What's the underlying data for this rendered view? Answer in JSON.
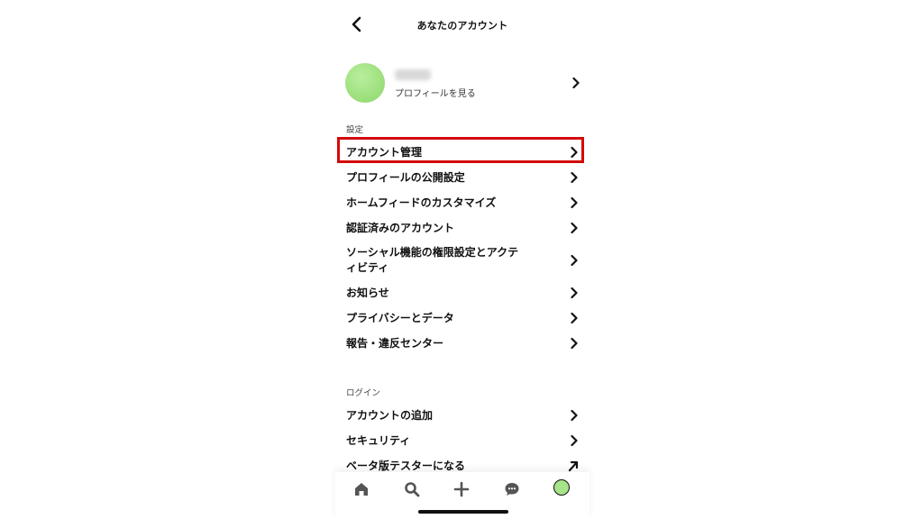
{
  "header": {
    "title": "あなたのアカウント"
  },
  "profile": {
    "sub_label": "プロフィールを見る"
  },
  "sections": {
    "settings_label": "設定",
    "login_label": "ログイン"
  },
  "settings_items": [
    {
      "label": "アカウント管理",
      "icon": "chevron-right-icon"
    },
    {
      "label": "プロフィールの公開設定",
      "icon": "chevron-right-icon"
    },
    {
      "label": "ホームフィードのカスタマイズ",
      "icon": "chevron-right-icon"
    },
    {
      "label": "認証済みのアカウント",
      "icon": "chevron-right-icon"
    },
    {
      "label_line1": "ソーシャル機能の権限設定とアクテ",
      "label_line2": "ィビティ",
      "icon": "chevron-right-icon"
    },
    {
      "label": "お知らせ",
      "icon": "chevron-right-icon"
    },
    {
      "label": "プライバシーとデータ",
      "icon": "chevron-right-icon"
    },
    {
      "label": "報告・違反センター",
      "icon": "chevron-right-icon"
    }
  ],
  "login_items": [
    {
      "label": "アカウントの追加",
      "icon": "chevron-right-icon"
    },
    {
      "label": "セキュリティ",
      "icon": "chevron-right-icon"
    },
    {
      "label": "ベータ版テスターになる",
      "icon": "arrow-up-right-icon"
    }
  ],
  "bottom_nav": [
    "home-icon",
    "search-icon",
    "plus-icon",
    "chat-icon",
    "profile-avatar"
  ],
  "colors": {
    "highlight": "#d40a0a",
    "avatar": "#a6e48a"
  }
}
